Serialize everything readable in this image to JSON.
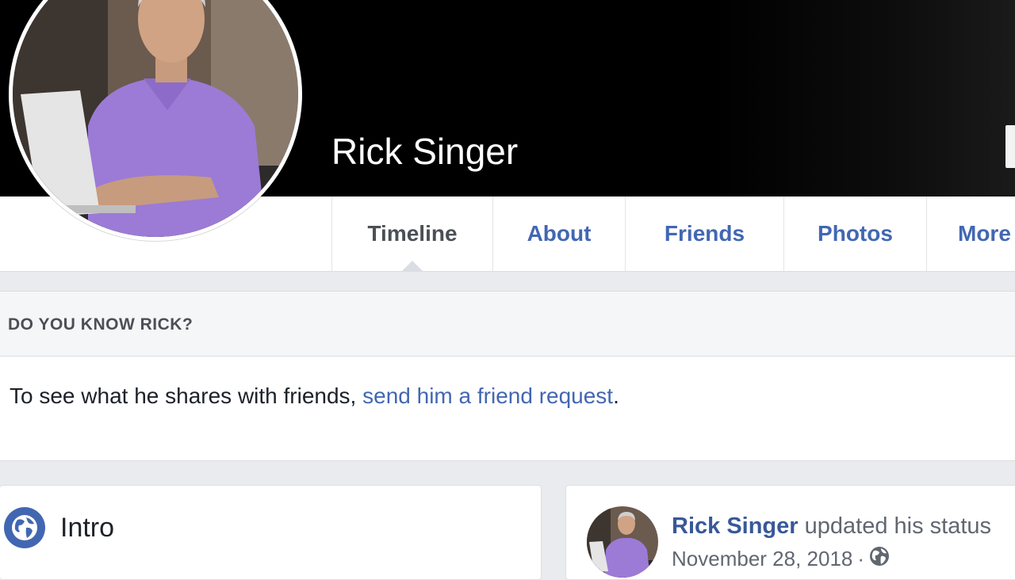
{
  "profile": {
    "name": "Rick Singer"
  },
  "tabs": [
    {
      "label": "Timeline",
      "active": true
    },
    {
      "label": "About",
      "active": false
    },
    {
      "label": "Friends",
      "active": false
    },
    {
      "label": "Photos",
      "active": false
    },
    {
      "label": "More",
      "active": false
    }
  ],
  "know_box": {
    "header": "DO YOU KNOW RICK?",
    "body_text": "To see what he shares with friends, ",
    "link_text": "send him a friend request",
    "trailing": "."
  },
  "intro": {
    "title": "Intro",
    "icon": "globe-icon"
  },
  "post": {
    "author": "Rick Singer",
    "action": "updated his status",
    "date": "November 28, 2018",
    "separator": "·",
    "audience_icon": "globe-icon"
  },
  "colors": {
    "accent": "#4267b2",
    "link": "#385898",
    "background": "#e9ebee",
    "cover": "#000000"
  }
}
